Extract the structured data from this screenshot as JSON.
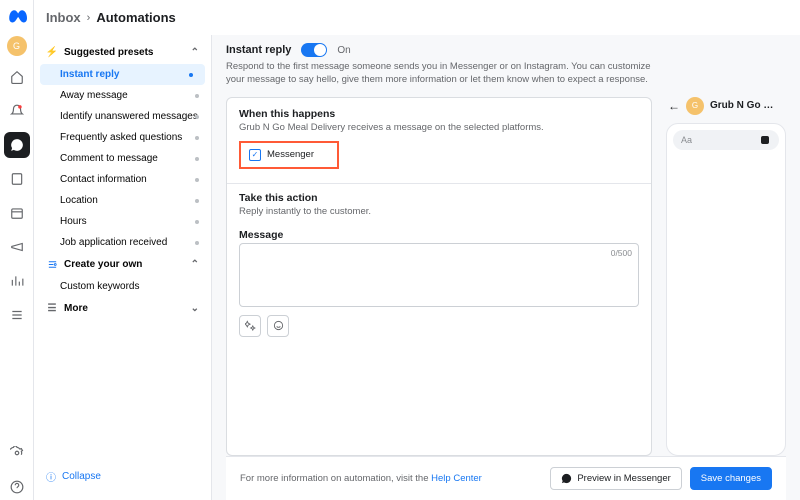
{
  "rail": {
    "avatar_letter": "G"
  },
  "breadcrumb": {
    "parent": "Inbox",
    "current": "Automations"
  },
  "sidebar": {
    "suggested_label": "Suggested presets",
    "presets": [
      {
        "label": "Instant reply",
        "selected": true
      },
      {
        "label": "Away message",
        "selected": false
      },
      {
        "label": "Identify unanswered messages",
        "selected": false
      },
      {
        "label": "Frequently asked questions",
        "selected": false
      },
      {
        "label": "Comment to message",
        "selected": false
      },
      {
        "label": "Contact information",
        "selected": false
      },
      {
        "label": "Location",
        "selected": false
      },
      {
        "label": "Hours",
        "selected": false
      },
      {
        "label": "Job application received",
        "selected": false
      }
    ],
    "create_label": "Create your own",
    "create_items": [
      {
        "label": "Custom keywords"
      }
    ],
    "more_label": "More",
    "collapse_label": "Collapse"
  },
  "panel": {
    "title": "Instant reply",
    "toggle_on_label": "On",
    "description": "Respond to the first message someone sends you in Messenger or on Instagram. You can customize your message to say hello, give them more information or let them know when to expect a response.",
    "when_title": "When this happens",
    "when_sub": "Grub N Go Meal Delivery receives a message on the selected platforms.",
    "platform_label": "Messenger",
    "action_title": "Take this action",
    "action_sub": "Reply instantly to the customer.",
    "message_label": "Message",
    "char_count": "0/500"
  },
  "preview": {
    "name": "Grub N Go M…",
    "placeholder": "Aa"
  },
  "footer": {
    "info_prefix": "For more information on automation, visit the ",
    "info_link": "Help Center",
    "preview_btn": "Preview in Messenger",
    "save_btn": "Save changes"
  }
}
